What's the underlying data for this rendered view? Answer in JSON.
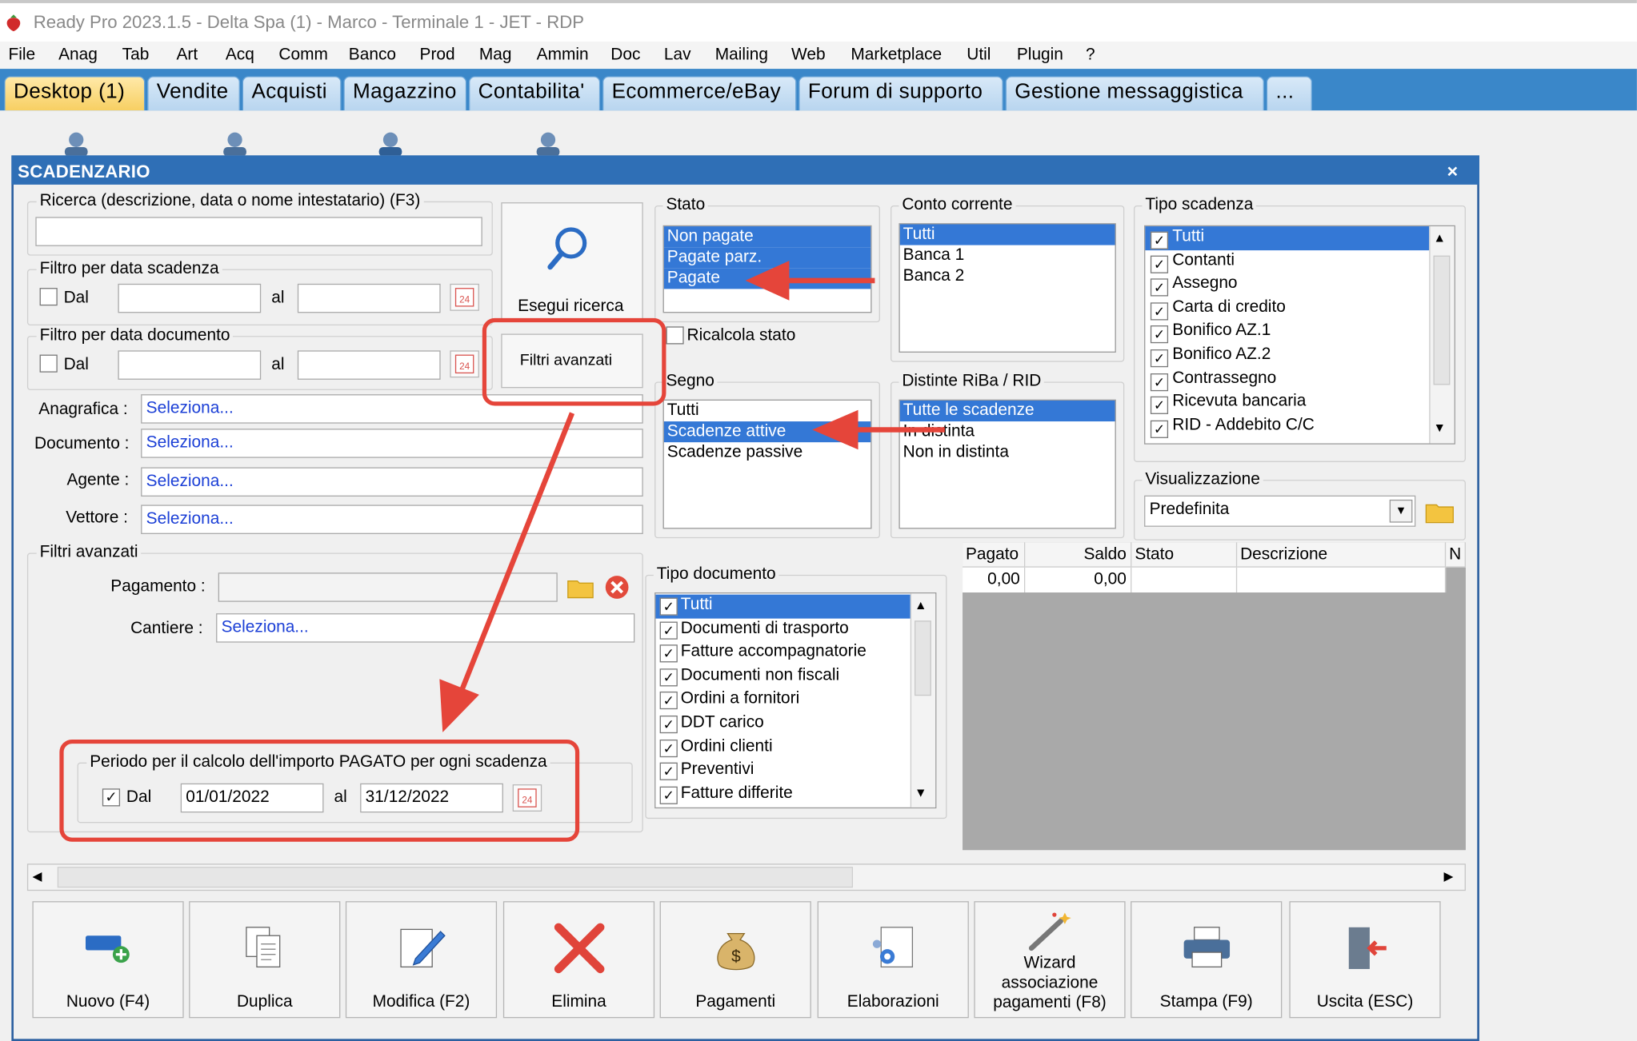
{
  "window": {
    "title": "Ready Pro 2023.1.5 - Delta Spa (1) - Marco - Terminale 1 - JET - RDP"
  },
  "menu": [
    "File",
    "Anag",
    "Tab",
    "Art",
    "Acq",
    "Comm",
    "Banco",
    "Prod",
    "Mag",
    "Ammin",
    "Doc",
    "Lav",
    "Mailing",
    "Web",
    "Marketplace",
    "Util",
    "Plugin",
    "?"
  ],
  "tabs": [
    "Desktop (1)",
    "Vendite",
    "Acquisti",
    "Magazzino",
    "Contabilita'",
    "Ecommerce/eBay",
    "Forum di supporto",
    "Gestione messaggistica",
    "..."
  ],
  "dialog": {
    "title": "SCADENZARIO",
    "close": "×",
    "search": {
      "legend": "Ricerca (descrizione, data o nome intestatario) (F3)",
      "value": ""
    },
    "due_date_filter": {
      "legend": "Filtro per data scadenza",
      "from_label": "Dal",
      "to_label": "al",
      "from": "",
      "to": "",
      "checked": false
    },
    "doc_date_filter": {
      "legend": "Filtro per data documento",
      "from_label": "Dal",
      "to_label": "al",
      "from": "",
      "to": "",
      "checked": false
    },
    "run_search": "Esegui ricerca",
    "advanced_filters_button": "Filtri avanzati",
    "fields": [
      {
        "label": "Anagrafica :",
        "value": "Seleziona..."
      },
      {
        "label": "Documento :",
        "value": "Seleziona..."
      },
      {
        "label": "Agente :",
        "value": "Seleziona..."
      },
      {
        "label": "Vettore :",
        "value": "Seleziona..."
      }
    ],
    "advanced": {
      "legend": "Filtri avanzati",
      "payment_label": "Pagamento :",
      "payment_value": "",
      "site_label": "Cantiere :",
      "site_value": "Seleziona...",
      "period": {
        "legend": "Periodo per il calcolo dell'importo PAGATO per ogni scadenza",
        "from_label": "Dal",
        "to_label": "al",
        "from": "01/01/2022",
        "to": "31/12/2022",
        "checked": true
      }
    },
    "stato": {
      "legend": "Stato",
      "items": [
        "Non pagate",
        "Pagate parz.",
        "Pagate"
      ],
      "recalc_label": "Ricalcola stato"
    },
    "conto": {
      "legend": "Conto corrente",
      "items": [
        "Tutti",
        "Banca 1",
        "Banca 2"
      ]
    },
    "tipo_scadenza": {
      "legend": "Tipo scadenza",
      "items": [
        "Tutti",
        "Contanti",
        "Assegno",
        "Carta di credito",
        "Bonifico AZ.1",
        "Bonifico AZ.2",
        "Contrassegno",
        "Ricevuta bancaria",
        "RID - Addebito C/C"
      ]
    },
    "segno": {
      "legend": "Segno",
      "items": [
        "Tutti",
        "Scadenze attive",
        "Scadenze passive"
      ]
    },
    "distinte": {
      "legend": "Distinte RiBa / RID",
      "items": [
        "Tutte le scadenze",
        "In distinta",
        "Non in distinta"
      ]
    },
    "visualizzazione": {
      "legend": "Visualizzazione",
      "value": "Predefinita"
    },
    "tipo_documento": {
      "legend": "Tipo documento",
      "items": [
        "Tutti",
        "Documenti di trasporto",
        "Fatture accompagnatorie",
        "Documenti non fiscali",
        "Ordini a fornitori",
        "DDT carico",
        "Ordini clienti",
        "Preventivi",
        "Fatture differite"
      ]
    },
    "grid": {
      "columns": [
        "Pagato",
        "Saldo",
        "Stato",
        "Descrizione",
        "N"
      ],
      "row": [
        "0,00",
        "0,00",
        "",
        ""
      ]
    },
    "buttons": [
      "Nuovo (F4)",
      "Duplica",
      "Modifica (F2)",
      "Elimina",
      "Pagamenti",
      "Elaborazioni",
      "Wizard associazione pagamenti (F8)",
      "Stampa (F9)",
      "Uscita (ESC)"
    ]
  },
  "colors": {
    "tabbar": "#3a87c9",
    "title": "#2f6fb6",
    "highlight": "#3478d6",
    "annotation": "#e5453a",
    "link": "#1b3fd6"
  }
}
